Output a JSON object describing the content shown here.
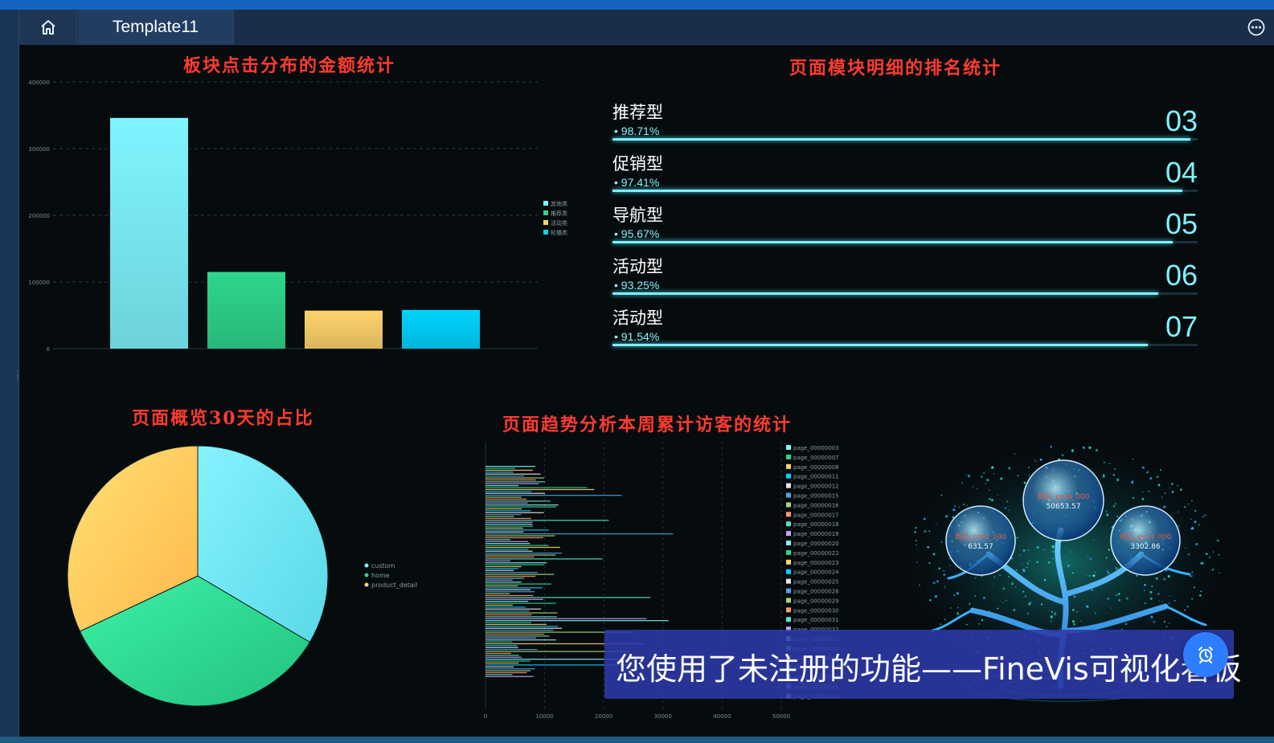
{
  "tab": {
    "title": "Template11"
  },
  "icons": {
    "home": "home-icon",
    "more": "more-icon",
    "alarm": "alarm-clock-icon"
  },
  "bar_panel": {
    "title": "板块点击分布的金额统计",
    "legend": [
      "其他类",
      "推荐类",
      "活动类",
      "轮播类"
    ]
  },
  "ranking_panel": {
    "title": "页面模块明细的排名统计",
    "items": [
      {
        "name": "推荐型",
        "pct": "98.71%",
        "rank": "03",
        "fill": 0.987
      },
      {
        "name": "促销型",
        "pct": "97.41%",
        "rank": "04",
        "fill": 0.974
      },
      {
        "name": "导航型",
        "pct": "95.67%",
        "rank": "05",
        "fill": 0.957
      },
      {
        "name": "活动型",
        "pct": "93.25%",
        "rank": "06",
        "fill": 0.9325
      },
      {
        "name": "活动型",
        "pct": "91.54%",
        "rank": "07",
        "fill": 0.9154
      }
    ]
  },
  "pie_panel": {
    "title": "页面概览30天的占比"
  },
  "hbar_panel": {
    "title": "页面趋势分析本周累计访客的统计",
    "legend": [
      "page_00000003",
      "page_00000007",
      "page_00000008",
      "page_00000011",
      "page_00000012",
      "page_00000015",
      "page_00000016",
      "page_00000017",
      "page_00000018",
      "page_00000019",
      "page_00000020",
      "page_00000022",
      "page_00000023",
      "page_00000024",
      "page_00000025",
      "page_00000028",
      "page_00000029",
      "page_00000030",
      "page_00000031",
      "page_00000032",
      "page_00000033",
      "page_00000035",
      "page_00000036",
      "page_00000038",
      "page_00000039",
      "page_00000041",
      "page_00000042"
    ]
  },
  "tree_panel": {
    "bubbles": [
      {
        "label": "商品_prod_000",
        "value": "50653.57"
      },
      {
        "label": "商品_prod_000",
        "value": "631.57"
      },
      {
        "label": "商品_prod_000",
        "value": "3302.86"
      }
    ]
  },
  "banner": {
    "text": "您使用了未注册的功能——FineVis可视化看板"
  },
  "colors": {
    "cyan": "#7ff5ff",
    "green": "#2ed68c",
    "yellow": "#ffd36b",
    "blue": "#00d4ff",
    "title_red": "#ff3b2f"
  },
  "chart_data": [
    {
      "type": "bar",
      "categories": [
        "其他类",
        "推荐类",
        "活动类",
        "轮播类"
      ],
      "series": [
        {
          "values": [
            346000,
            115000,
            57000,
            58000
          ]
        }
      ],
      "ylim": [
        0,
        400000
      ],
      "yticks": [
        "0",
        "100000",
        "200000",
        "300000",
        "400000"
      ],
      "grid": true,
      "legend_position": "right"
    },
    {
      "type": "pie",
      "labels": [
        "custom",
        "home",
        "product_detail"
      ],
      "values": [
        33.5,
        34.5,
        32
      ],
      "legend_position": "right"
    },
    {
      "type": "bar",
      "orientation": "horizontal",
      "xticks": [
        "0",
        "10000",
        "20000",
        "30000",
        "40000",
        "50000"
      ],
      "xlim": [
        0,
        50000
      ],
      "grid": true,
      "legend_position": "right"
    }
  ]
}
